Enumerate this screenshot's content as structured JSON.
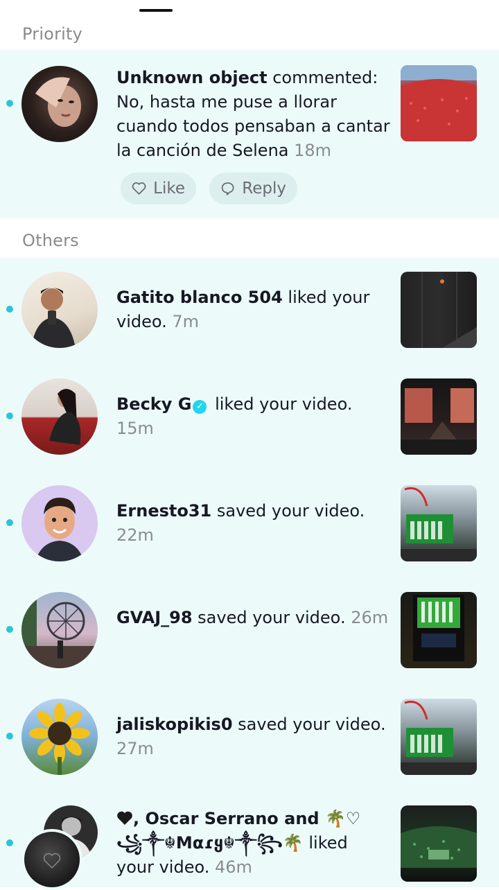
{
  "sections": {
    "priority_label": "Priority",
    "others_label": "Others"
  },
  "priority": {
    "name": "Unknown object",
    "action": " commented: No, hasta me puse a llorar cuando todos pensaban a cantar la canción de Selena ",
    "time": "18m",
    "like_label": "Like",
    "reply_label": "Reply"
  },
  "notifications": [
    {
      "name": "Gatito blanco 504",
      "action": " liked your video. ",
      "time": "7m"
    },
    {
      "name": "Becky G",
      "action": " liked your video. ",
      "time": "15m"
    },
    {
      "name": "Ernesto31",
      "action": " saved your video. ",
      "time": "22m"
    },
    {
      "name": "GVAJ_98",
      "action": " saved your video. ",
      "time": "26m"
    },
    {
      "name": "jaliskopikis0",
      "action": " saved your video. ",
      "time": "27m"
    },
    {
      "name_prefix": ", Oscar Serrano and ",
      "name_suffix": "🌴♡ ꧁༒☬Mαɾყ☬༒꧂🌴",
      "action": " liked your video. ",
      "time": "46m"
    }
  ],
  "colors": {
    "accent_dot": "#2ec4d6",
    "band_background": "#ecfbfa",
    "pill_background": "#ddeeee",
    "verified_badge": "#20d5ec"
  }
}
